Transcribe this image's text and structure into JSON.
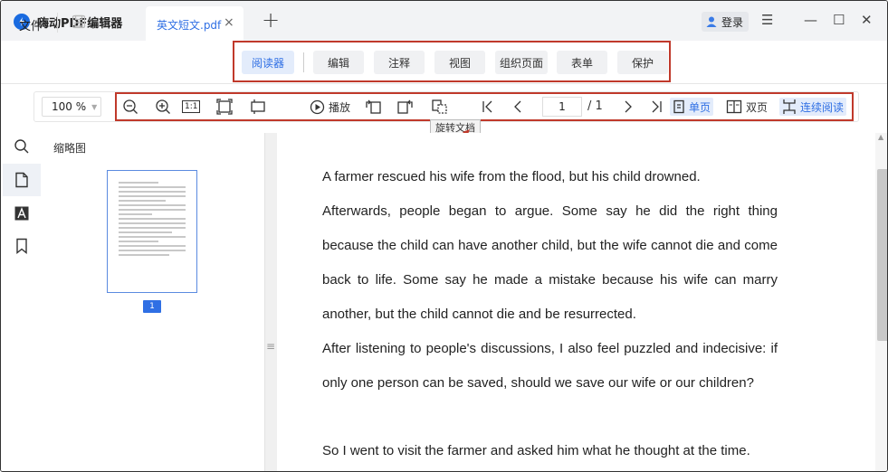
{
  "app": {
    "title": "嗨动PDF编辑器"
  },
  "tab": {
    "label": "英文短文.pdf",
    "close": "×",
    "new": "+"
  },
  "account": {
    "login_label": "登录"
  },
  "window_controls": {
    "menu": "☰",
    "minimize": "—",
    "maximize": "☐",
    "close": "✕"
  },
  "menubar": {
    "file_label": "文件",
    "ribbon": [
      "阅读器",
      "编辑",
      "注释",
      "视图",
      "组织页面",
      "表单",
      "保护"
    ],
    "active": "阅读器"
  },
  "toolbar": {
    "zoom_value": "100 %",
    "fit_actual_label": "1:1",
    "play_label": "播放",
    "page_current": "1",
    "page_total": "/ 1",
    "single_page_label": "单页",
    "double_page_label": "双页",
    "continuous_label": "连续阅读",
    "tooltip": "旋转文档"
  },
  "sidebar": {
    "thumbnail_title": "缩略图",
    "page_badge": "1",
    "icons": [
      "search-icon",
      "page-icon",
      "text-icon",
      "bookmark-icon"
    ]
  },
  "document": {
    "paragraphs": [
      "A farmer rescued his wife from the flood, but his child drowned.",
      "Afterwards, people began to argue. Some say he did the right thing because the child can have another child, but the wife cannot die and come back to life. Some say he made a mistake because his wife can marry another, but the child cannot die and be resurrected.",
      "After listening to people's discussions, I also feel puzzled and indecisive: if only one person can be saved, should we save our wife or our children?",
      "So I went to visit the farmer and asked him what he thought at the time."
    ]
  },
  "colors": {
    "accent": "#2f6fe4",
    "highlight_box": "#c0392b"
  }
}
